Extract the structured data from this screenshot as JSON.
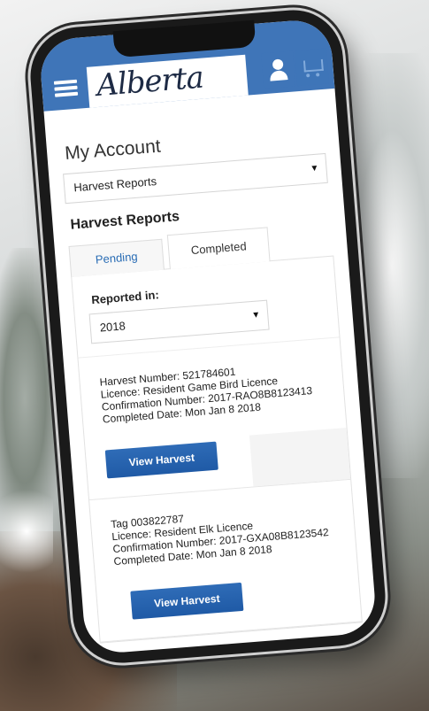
{
  "header": {
    "brand": "Alberta"
  },
  "account": {
    "title": "My Account",
    "section_select": "Harvest Reports",
    "section_title": "Harvest Reports"
  },
  "tabs": [
    {
      "label": "Pending",
      "active": false
    },
    {
      "label": "Completed",
      "active": true
    }
  ],
  "filter": {
    "label": "Reported in:",
    "value": "2018"
  },
  "records": [
    {
      "id_line": "Harvest Number: 521784601",
      "licence": "Licence: Resident Game Bird Licence",
      "confirmation": "Confirmation Number: 2017-RAO8B8123413",
      "completed": "Completed Date: Mon Jan 8 2018",
      "button": "View Harvest"
    },
    {
      "id_line": "Tag  003822787",
      "licence": "Licence: Resident Elk Licence",
      "confirmation": "Confirmation Number: 2017-GXA08B8123542",
      "completed": "Completed Date: Mon Jan 8 2018",
      "button": "View Harvest"
    }
  ],
  "colors": {
    "brand_blue": "#3f75b8",
    "button_blue": "#1f5aa6",
    "link_blue": "#2a6db5"
  },
  "icons": [
    "hamburger-menu-icon",
    "user-icon",
    "cart-icon",
    "dropdown-caret-icon"
  ]
}
